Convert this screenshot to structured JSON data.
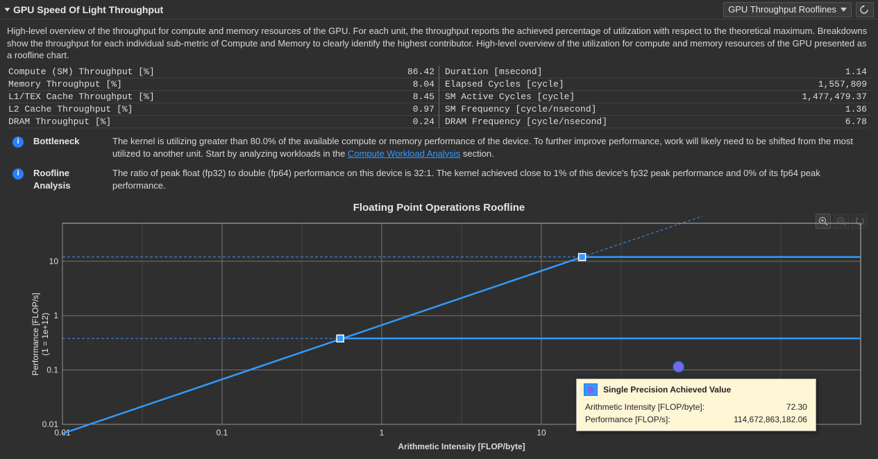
{
  "header": {
    "title": "GPU Speed Of Light Throughput",
    "combo": "GPU Throughput Rooflines"
  },
  "description": "High-level overview of the throughput for compute and memory resources of the GPU. For each unit, the throughput reports the achieved percentage of utilization with respect to the theoretical maximum. Breakdowns show the throughput for each individual sub-metric of Compute and Memory to clearly identify the highest contributor. High-level overview of the utilization for compute and memory resources of the GPU presented as a roofline chart.",
  "metrics_left": [
    {
      "k": "Compute (SM) Throughput [%]",
      "v": "86.42"
    },
    {
      "k": "Memory Throughput [%]",
      "v": "8.04"
    },
    {
      "k": "L1/TEX Cache Throughput [%]",
      "v": "8.45"
    },
    {
      "k": "L2 Cache Throughput [%]",
      "v": "0.97"
    },
    {
      "k": "DRAM Throughput [%]",
      "v": "0.24"
    }
  ],
  "metrics_right": [
    {
      "k": "Duration [msecond]",
      "v": "1.14"
    },
    {
      "k": "Elapsed Cycles [cycle]",
      "v": "1,557,809"
    },
    {
      "k": "SM Active Cycles [cycle]",
      "v": "1,477,479.37"
    },
    {
      "k": "SM Frequency [cycle/nsecond]",
      "v": "1.36"
    },
    {
      "k": "DRAM Frequency [cycle/nsecond]",
      "v": "6.78"
    }
  ],
  "bottleneck": {
    "label": "Bottleneck",
    "text_a": "The kernel is utilizing greater than 80.0% of the available compute or memory performance of the device. To further improve performance, work will likely need to be shifted from the most utilized to another unit. Start by analyzing workloads in the ",
    "link": "Compute Workload Analysis",
    "text_b": " section."
  },
  "roofline": {
    "label": "Roofline Analysis",
    "text": "The ratio of peak float (fp32) to double (fp64) performance on this device is 32:1. The kernel achieved  close to 1% of this device's fp32 peak performance and 0% of its fp64 peak performance."
  },
  "chart": {
    "title": "Floating Point Operations Roofline",
    "ylabel": "Performance [FLOP/s]\n(1 = 1e+12)",
    "xlabel": "Arithmetic Intensity [FLOP/byte]",
    "xticks": [
      "0.01",
      "0.1",
      "1",
      "10"
    ],
    "yticks": [
      "0.01",
      "0.1",
      "1",
      "10"
    ]
  },
  "tooltip": {
    "title": "Single Precision Achieved Value",
    "rows": [
      {
        "k": "Arithmetic Intensity [FLOP/byte]:",
        "v": "72.30"
      },
      {
        "k": "Performance [FLOP/s]:",
        "v": "114,672,863,182.06"
      }
    ]
  },
  "chart_data": {
    "type": "roofline",
    "xaxis": {
      "label": "Arithmetic Intensity [FLOP/byte]",
      "scale": "log",
      "range": [
        0.01,
        1000
      ]
    },
    "yaxis": {
      "label": "Performance [FLOP/s] (1 = 1e+12)",
      "scale": "log",
      "range": [
        0.01,
        50
      ]
    },
    "ceilings": [
      {
        "name": "fp32 peak",
        "value": 12
      },
      {
        "name": "fp64 peak",
        "value": 0.38
      }
    ],
    "ridge_points": [
      {
        "name": "fp32 ridge",
        "x": 18,
        "y": 12
      },
      {
        "name": "fp64 ridge",
        "x": 0.55,
        "y": 0.38
      }
    ],
    "achieved": [
      {
        "name": "Single Precision Achieved Value",
        "arithmetic_intensity": 72.3,
        "performance_flops": 114672863182.06
      }
    ]
  }
}
